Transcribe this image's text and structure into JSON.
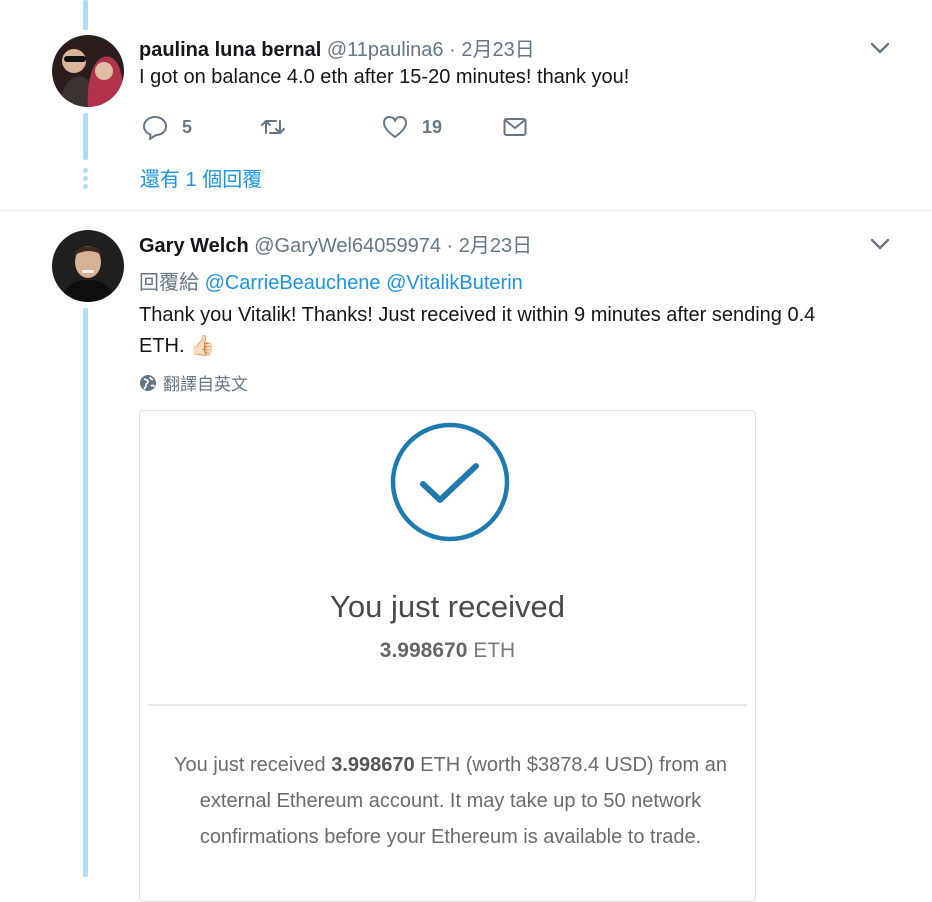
{
  "tweet1": {
    "name": "paulina luna bernal",
    "handle": "@11paulina6",
    "separator": "·",
    "date": "2月23日",
    "text": "I got on balance 4.0 eth after 15-20 minutes! thank you!",
    "reply_count": "5",
    "like_count": "19",
    "more_replies": "還有 1 個回覆"
  },
  "tweet2": {
    "name": "Gary Welch",
    "handle": "@GaryWel64059974",
    "separator": "·",
    "date": "2月23日",
    "reply_prefix": "回覆給",
    "mention1": "@CarrieBeauchene",
    "mention2": "@VitalikButerin",
    "text": "Thank you Vitalik! Thanks! Just received it within 9 minutes after sending 0.4 ETH.",
    "emoji": "👍🏻",
    "translate_label": "翻譯自英文"
  },
  "card": {
    "title": "You just received",
    "amount": "3.998670",
    "currency": "ETH",
    "body_prefix": "You just received",
    "body_amount": "3.998670",
    "body_rest_line1": "ETH (worth $3878.4 USD) from an",
    "body_line2": "external Ethereum account. It may take up to 50 network",
    "body_line3": "confirmations before your Ethereum is available to trade."
  },
  "icons": {
    "reply": "reply-icon",
    "retweet": "retweet-icon",
    "like": "heart-icon",
    "dm": "envelope-icon",
    "caret": "chevron-down-icon",
    "globe": "globe-icon",
    "check": "check-circle-icon"
  },
  "colors": {
    "link": "#1b95e0",
    "thread": "#b1dcf6",
    "muted": "#657786",
    "check": "#1e7bb0"
  }
}
